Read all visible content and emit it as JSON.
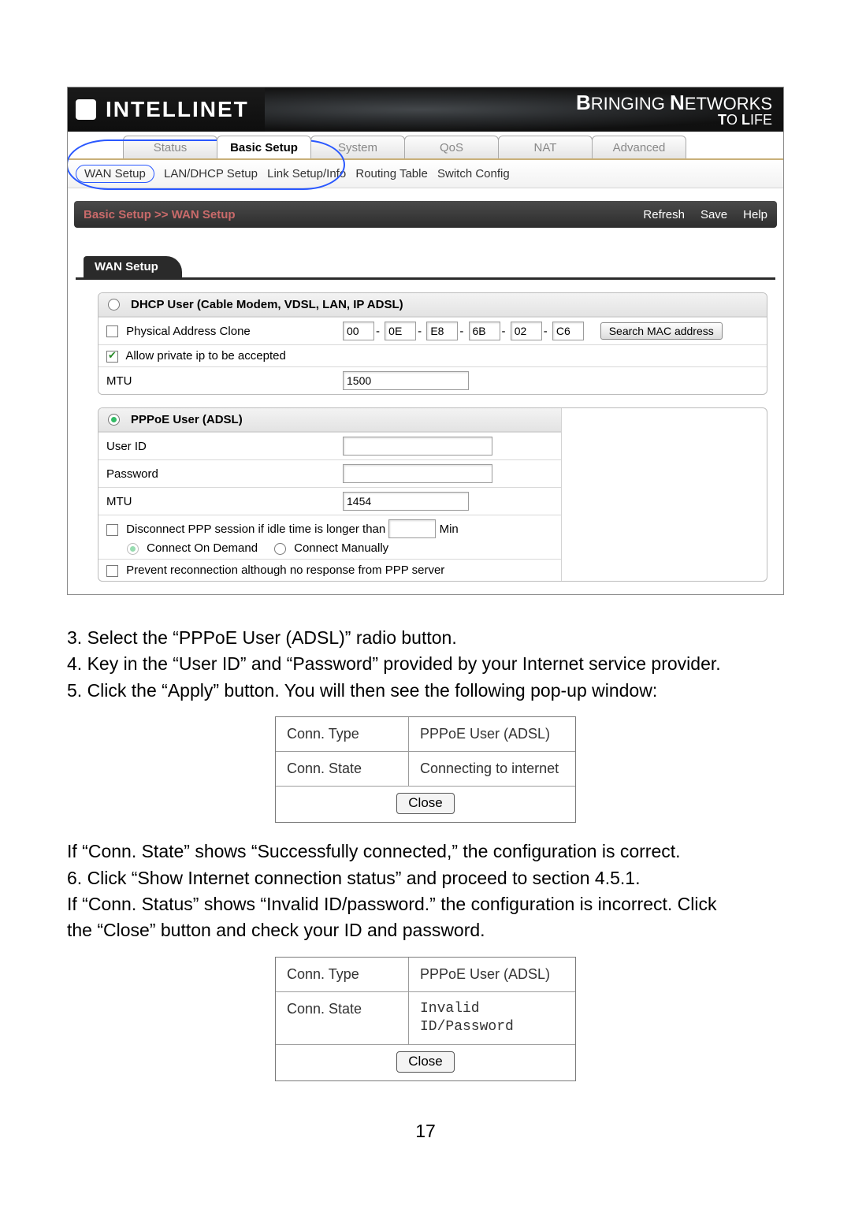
{
  "banner": {
    "brand": "INTELLINET",
    "slogan1_left": "B",
    "slogan1_rest": "RINGING",
    "slogan1_b2": "N",
    "slogan1_rest2": "ETWORKS",
    "slogan2_left": "T",
    "slogan2_rest": "O",
    "slogan2_b2": "L",
    "slogan2_rest2": "IFE"
  },
  "tabs": {
    "status": "Status",
    "basic": "Basic Setup",
    "system": "System",
    "qos": "QoS",
    "nat": "NAT",
    "advanced": "Advanced"
  },
  "subnav": {
    "wan": "WAN Setup",
    "lan": "LAN/DHCP Setup",
    "link": "Link Setup/Info",
    "routing": "Routing Table",
    "switch": "Switch Config"
  },
  "crumb": {
    "path": "Basic Setup >> WAN Setup",
    "refresh": "Refresh",
    "save": "Save",
    "help": "Help"
  },
  "section": {
    "title": "WAN Setup"
  },
  "dhcp": {
    "title": "DHCP User (Cable Modem, VDSL, LAN, IP ADSL)",
    "pac": "Physical Address Clone",
    "mac": [
      "00",
      "0E",
      "E8",
      "6B",
      "02",
      "C6"
    ],
    "search": "Search MAC address",
    "allow": "Allow private ip to be accepted",
    "mtu_label": "MTU",
    "mtu": "1500"
  },
  "pppoe": {
    "title": "PPPoE User (ADSL)",
    "userid_label": "User ID",
    "userid": "",
    "password_label": "Password",
    "password": "",
    "mtu_label": "MTU",
    "mtu": "1454",
    "disc_pre": "Disconnect PPP session if idle time is longer than",
    "disc_post": "Min",
    "cod": "Connect On Demand",
    "cm": "Connect Manually",
    "prevent": "Prevent reconnection although no response from PPP server"
  },
  "instr": {
    "s3": "3. Select the “PPPoE User (ADSL)” radio button.",
    "s4": "4. Key in the “User ID” and “Password” provided by your Internet service provider.",
    "s5": "5. Click the “Apply” button. You will then see the following pop-up window:",
    "p1": {
      "conn_type_l": "Conn. Type",
      "conn_type_v": "PPPoE User (ADSL)",
      "conn_state_l": "Conn. State",
      "conn_state_v": "Connecting to internet",
      "close": "Close"
    },
    "after1": "If “Conn. State” shows “Successfully connected,” the configuration is correct.",
    "s6": "6. Click “Show Internet connection status” and proceed to section 4.5.1.",
    "after2a": "If “Conn. Status” shows “Invalid ID/password.” the configuration is incorrect. Click",
    "after2b": "the “Close” button and check your ID and password.",
    "p2": {
      "conn_type_l": "Conn. Type",
      "conn_type_v": "PPPoE User (ADSL)",
      "conn_state_l": "Conn. State",
      "conn_state_v": "Invalid ID/Password",
      "close": "Close"
    }
  },
  "pagenum": "17"
}
